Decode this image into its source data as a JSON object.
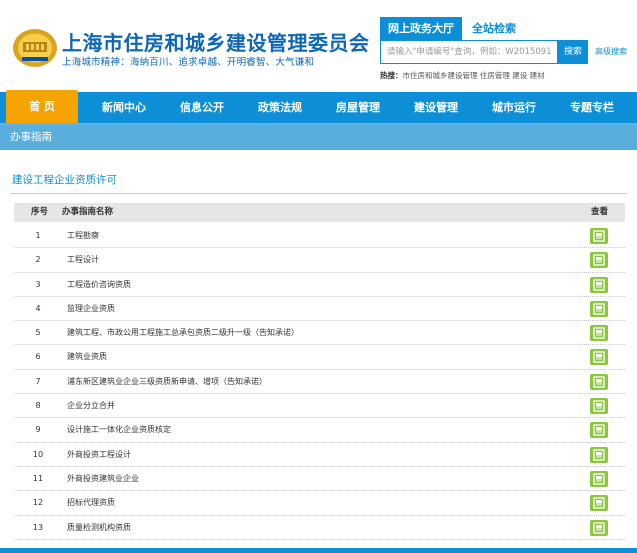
{
  "header": {
    "title": "上海市住房和城乡建设管理委员会",
    "slogan": "上海城市精神：海纳百川、追求卓越、开明睿智、大气谦和",
    "tab_gov": "网上政务大厅",
    "tab_search": "全站检索",
    "search_placeholder": "请输入\"申请编号\"查询，例如：W2015091",
    "search_button": "搜索",
    "advanced_search": "高级搜索",
    "hot_label": "热搜：",
    "hot_items": "市住房和城乡建设管理  住房管理  建设  建材"
  },
  "nav": {
    "items": [
      {
        "label": "首 页"
      },
      {
        "label": "新闻中心"
      },
      {
        "label": "信息公开"
      },
      {
        "label": "政策法规"
      },
      {
        "label": "房屋管理"
      },
      {
        "label": "建设管理"
      },
      {
        "label": "城市运行"
      },
      {
        "label": "专题专栏"
      }
    ]
  },
  "section": {
    "title": "办事指南",
    "subtitle": "建设工程企业资质许可"
  },
  "table": {
    "headers": {
      "num": "序号",
      "name": "办事指南名称",
      "view": "查看"
    },
    "rows": [
      {
        "num": "1",
        "name": "工程勘察"
      },
      {
        "num": "2",
        "name": "工程设计"
      },
      {
        "num": "3",
        "name": "工程造价咨询资质"
      },
      {
        "num": "4",
        "name": "监理企业资质"
      },
      {
        "num": "5",
        "name": "建筑工程、市政公用工程施工总承包资质二级升一级（告知承诺）"
      },
      {
        "num": "6",
        "name": "建筑业资质"
      },
      {
        "num": "7",
        "name": "浦东新区建筑业企业三级资质新申请、增项（告知承诺）"
      },
      {
        "num": "8",
        "name": "企业分立合并"
      },
      {
        "num": "9",
        "name": "设计施工一体化企业资质核定"
      },
      {
        "num": "10",
        "name": "外商投资工程设计"
      },
      {
        "num": "11",
        "name": "外商投资建筑业企业"
      },
      {
        "num": "12",
        "name": "招标代理资质"
      },
      {
        "num": "13",
        "name": "质量检测机构资质"
      }
    ]
  },
  "colors": {
    "primary": "#0d8fd8",
    "nav_active": "#f5a300",
    "view_button": "#8cc63f",
    "title_blue": "#0d67b5"
  }
}
